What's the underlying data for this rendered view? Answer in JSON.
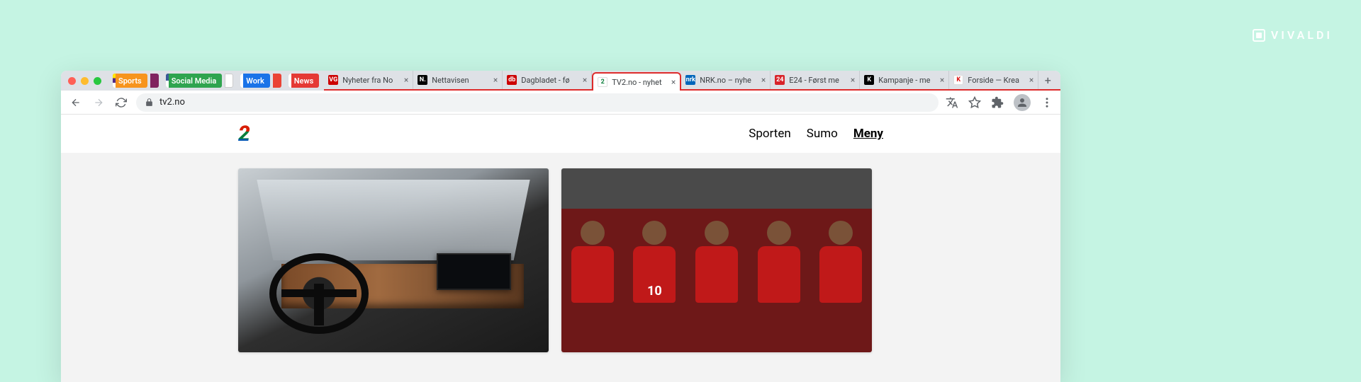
{
  "watermark": "VIVALDI",
  "stacks": [
    {
      "label": "Sports",
      "class": "stack-sports",
      "mini": "mini-sports"
    },
    {
      "label": "Social Media",
      "class": "stack-social",
      "mini": "mini-social"
    },
    {
      "label": "Work",
      "class": "stack-work",
      "mini": "mini-work"
    },
    {
      "label": "News",
      "class": "stack-news",
      "mini": null
    }
  ],
  "tabs": [
    {
      "title": "Nyheter fra No",
      "fav_bg": "#c00",
      "fav_txt": "VG",
      "active": false
    },
    {
      "title": "Nettavisen",
      "fav_bg": "#000",
      "fav_txt": "N.",
      "active": false
    },
    {
      "title": "Dagbladet - fø",
      "fav_bg": "#c00",
      "fav_txt": "db",
      "active": false
    },
    {
      "title": "TV2.no - nyhet",
      "fav_bg": "#fff",
      "fav_txt": "2",
      "active": true,
      "fav_col": "#0a7d3a"
    },
    {
      "title": "NRK.no – nyhe",
      "fav_bg": "#06b",
      "fav_txt": "nrk",
      "active": false
    },
    {
      "title": "E24 - Først me",
      "fav_bg": "#d8232a",
      "fav_txt": "24",
      "active": false
    },
    {
      "title": "Kampanje - me",
      "fav_bg": "#000",
      "fav_txt": "K",
      "active": false
    },
    {
      "title": "Forside — Krea",
      "fav_bg": "#fff",
      "fav_txt": "K",
      "active": false,
      "fav_col": "#d11"
    }
  ],
  "url": "tv2.no",
  "nav": {
    "back": "←",
    "forward": "→",
    "reload": "⟳",
    "newtab": "+"
  },
  "site": {
    "logo": "2",
    "menu": {
      "sporten": "Sporten",
      "sumo": "Sumo",
      "meny": "Meny"
    },
    "cards": {
      "players": [
        "",
        "10",
        "",
        "",
        ""
      ]
    }
  }
}
